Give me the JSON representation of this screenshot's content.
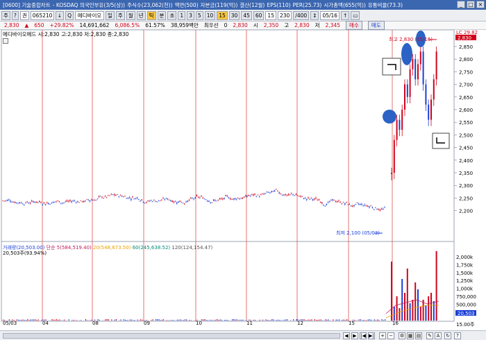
{
  "titlebar": {
    "items": [
      "[0600] 기술중합차트",
      "- KOSDAQ 의국인부유(3/5(상))",
      "주식수(23,062(천))",
      "액면(500)",
      "자본금(119(억))",
      "결산(12월)",
      "EPS(110)",
      "PER(25.73)",
      "시가총액(655(억))",
      "유통비율(73.3)"
    ],
    "buttons": [
      "_",
      "□",
      "×"
    ]
  },
  "toolbar": {
    "items": [
      "주",
      "?",
      "권",
      "065210",
      "↓",
      "Q",
      "메디바이오",
      "일",
      "주",
      "월",
      "년",
      "틱",
      "분",
      "초",
      "1",
      "3",
      "5",
      "10",
      "15",
      "30",
      "45",
      "60",
      "15",
      "230",
      "/400",
      "↕",
      "05/16",
      "↑",
      "▭"
    ]
  },
  "pricebar": {
    "price": "2,830",
    "change": "650",
    "change_pct": "+29.82%",
    "volume": "14,691,662",
    "amount": "6,086.5%",
    "turnover": "61.57%",
    "value": "38,959백만",
    "label_recent": "최우선",
    "zero": "0",
    "close": "2,830",
    "open_label": "시",
    "open": "2,350",
    "high_label": "고",
    "high": "2,830",
    "low_label": "저",
    "low": "2,345",
    "buy_button": "매수",
    "sell_button": "매도"
  },
  "chart_info": "메디바이오메드 시:2,830 고:2,830 저:2,830 종:2,830",
  "annotations": {
    "high_label": "최고 2,830 (05/16)",
    "low_label": "최저 2,100 (05/03)",
    "lc_label": "LC 29.82"
  },
  "price_axis": [
    "2,850",
    "2,800",
    "2,750",
    "2,700",
    "2,650",
    "2,600",
    "2,550",
    "2,500",
    "2,450",
    "2,400",
    "2,350",
    "2,300",
    "2,250",
    "2,200"
  ],
  "volume_info": {
    "line1_a": "거래량(20,503.00)",
    "line1_b": "단순 5(584,519.40)",
    "line1_c": "20(548,673.50)",
    "line1_d": "60(245,638.52)",
    "line1_e": "120(124,154.47)",
    "line2": "20,503주(93.94%)"
  },
  "volume_axis": [
    "2,000k",
    "1,750k",
    "1,500k",
    "1,250k",
    "1,000k",
    "750,000",
    "500,000",
    "250,000"
  ],
  "volume_axis_badge": "20,503",
  "volume_axis_bottom": "15.00주",
  "x_axis": [
    "05/03",
    "04",
    "08",
    "09",
    "10",
    "11",
    "12",
    "15",
    "16"
  ],
  "colors": {
    "up": "#d0021b",
    "down": "#1a3fd6",
    "vline": "#d9534f",
    "marker": "#2a62c6"
  }
}
